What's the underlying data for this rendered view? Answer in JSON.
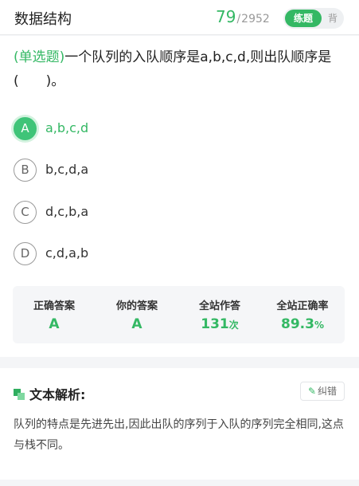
{
  "header": {
    "title": "数据结构",
    "progress_current": "79",
    "progress_separator": "/",
    "progress_total": "2952",
    "mode_practice": "练题",
    "mode_recite": "背"
  },
  "question": {
    "type_label": "(单选题)",
    "text": "一个队列的入队顺序是a,b,c,d,则出队顺序是(　　)。"
  },
  "options": [
    {
      "letter": "A",
      "text": "a,b,c,d",
      "correct": true
    },
    {
      "letter": "B",
      "text": "b,c,d,a",
      "correct": false
    },
    {
      "letter": "C",
      "text": "d,c,b,a",
      "correct": false
    },
    {
      "letter": "D",
      "text": "c,d,a,b",
      "correct": false
    }
  ],
  "stats": {
    "correct_answer": {
      "label": "正确答案",
      "value": "A"
    },
    "your_answer": {
      "label": "你的答案",
      "value": "A"
    },
    "site_attempts": {
      "label": "全站作答",
      "value": "131",
      "unit": "次"
    },
    "site_accuracy": {
      "label": "全站正确率",
      "value": "89.3",
      "unit": "%"
    }
  },
  "analysis": {
    "title": "文本解析:",
    "report_label": "纠错",
    "text": "队列的特点是先进先出,因此出队的序列于入队的序列完全相同,这点与栈不同。"
  },
  "icons": {
    "analysis_icon": "squares-icon",
    "report_icon": "edit-icon"
  },
  "colors": {
    "accent": "#34b864",
    "accent_light": "#3fc478"
  }
}
